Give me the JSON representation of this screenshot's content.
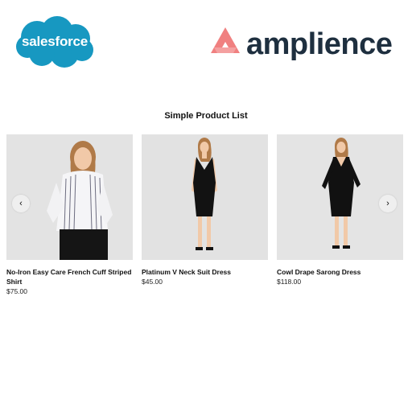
{
  "header": {
    "salesforce_logo_text": "salesforce",
    "amplience_logo_text": "amplience"
  },
  "product_list": {
    "title": "Simple Product List",
    "prev_arrow": "‹",
    "next_arrow": "›",
    "products": [
      {
        "name": "No-Iron Easy Care French Cuff Striped Shirt",
        "price": "$75.00"
      },
      {
        "name": "Platinum V Neck Suit Dress",
        "price": "$45.00"
      },
      {
        "name": "Cowl Drape Sarong Dress",
        "price": "$118.00"
      }
    ]
  },
  "colors": {
    "salesforce_blue": "#1798c1",
    "amplience_coral": "#f08080",
    "amplience_navy": "#1e2f3f"
  }
}
